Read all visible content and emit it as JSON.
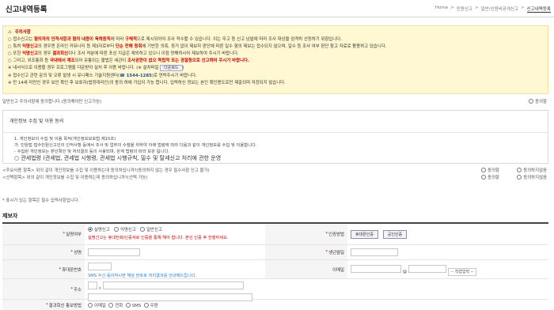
{
  "header": {
    "title": "신고내역등록",
    "breadcrumb": [
      "Home",
      ">",
      "민원신고",
      ">",
      "일반/신원비공개신고",
      ">",
      "신고내역등록"
    ]
  },
  "notice": {
    "title": "주의사항",
    "lines": [
      {
        "pre": "○ 접수신고는 ",
        "hl1": "혐의자의 인적사항과 혐의 내용이 육하원칙",
        "mid": "에 따라 ",
        "hl2": "구체적",
        "post": "으로 제시되어야 조사 작수할 수 있습니다. 이는 무고 등 신고 남발에 따라 조사 대상을 엄격히 선정하기 위함입니다."
      },
      {
        "pre": "○ 특히 ",
        "hl1": "익명신고",
        "mid": "의 경우엔 온라인 커뮤니티 등 제3자로부터 ",
        "hl2": "단순 전해 청취",
        "post": "에 기반한 의혹, 증거 없이 제보자 판단에 따른 일수 혐의 제보는 접수되지 않으며, 일수 등 조사 여부 판단 참고 자료로 활용하고 있습니다."
      },
      {
        "pre": "○ 또한 ",
        "hl1": "익명신고",
        "mid": "의 경우 ",
        "hl2": "결과회신",
        "post": "이나 조사 처분에 따른 포상 지급은 제외하고 있으니 이점 양해하시어 제보하여 주시기 바랍니다."
      },
      {
        "pre": "○ 그리고, 위조통화 등 ",
        "hl1": "국내에서 제조",
        "mid": "되어 유통되는 불법은 세관이 ",
        "hl2": "조사권한",
        "post": "이 없으 독립적 또는 경찰청으로 신고하여 주시기 바랍니다."
      },
      {
        "pre": "※ 내서식으로 이용할 경우 프로그램을 다운받아 설치 후 이용 바랍니다. (※ 설치파일 ",
        "hl1": "",
        "mid": "",
        "hl2": "",
        "post": "다운로드"
      },
      {
        "pre": "※ 접수신고 관련 문의 및 오류 발생 시 유니패스 기술지원센터(",
        "hl1": "☎ 1544-1285",
        "mid": ")로 연락주시기 바랍니다.",
        "hl2": "",
        "post": ""
      },
      {
        "pre": "※ 만 14세 미만인 경우 보안 확인 후 보호자(법정대리인)의 동의 하에 가입이 가능 합니다. 입력하신 정보는 본인 확인용도로만 제출되며 저장되지 않습니다.",
        "hl1": "",
        "mid": "",
        "hl2": "",
        "post": ""
      }
    ]
  },
  "consent_top": {
    "text": "일반신고 주의사항에 동의합니다.(동의해야만 신고가능)",
    "option": "동의함"
  },
  "privacy": {
    "head": "개인정보 수집 및 이용 동의",
    "lines": [
      "1. 개인정보의 수집 및 이용 목적(개인정보보호법 제15조)",
      "가. 민원접 접수민원신고인의 인적사항 등에서 조사 및 업무의 수행을 위하여 아래 법령에 따라 다음과 같이 개인정보를 수집 및 이용합니다.",
      "- 수집된 개인정보는 본인확인 및 처리결과 등의 사용되며, 관계 법령의 따라 보관 됩니다."
    ],
    "law": "○ 관세법령 (관세법, 관세법 시행령, 관세법 시행규칙, 밀수 및 탈세신고 처리에 관한 운영"
  },
  "consents": [
    {
      "text": "<주요사용 항목> 위의 같이 개인정보를 수집 및 이용하는데 동의하십니까?(동의하지 않는 경우 필수사항 신고 불가)",
      "agree": "동의함",
      "disagree": "동의하지않음"
    },
    {
      "text": "<선택항목> 위의 같이 개인정보를 수집 및 이용하는데 동의하십니까?(선택 가능)",
      "agree": "동의함",
      "disagree": "동의하지않음"
    }
  ],
  "required_note": "* 표시가 있는 항목은 필수 입력사항입니다.",
  "section_title": "제보자",
  "form": {
    "type_label": "실명여부",
    "type_options": [
      "실명신고",
      "익명신고",
      "일반신고"
    ],
    "type_warn": "실명신고는 휴대전화/인증서로 인증을 통해 해야 합니다. 본인 인증 후 진행하세요.",
    "auth_label": "인증방법",
    "auth_buttons": [
      "휴대폰인증",
      "공인인증"
    ],
    "name_label": "성명",
    "birth_label": "생년월일",
    "mobile_label": "휴대폰번호",
    "mobile_hint": "SMS 수신 동의하시면 해당 번호로 처리결과를 안내해드립니다.",
    "email_label": "이메일",
    "email_at": "@",
    "email_select": "-- 직접입력 --",
    "addr_label": "주소",
    "contact_label": "결과회신 통보방법",
    "contact_options": [
      "이메일",
      "전화",
      "SMS",
      "우편"
    ]
  }
}
